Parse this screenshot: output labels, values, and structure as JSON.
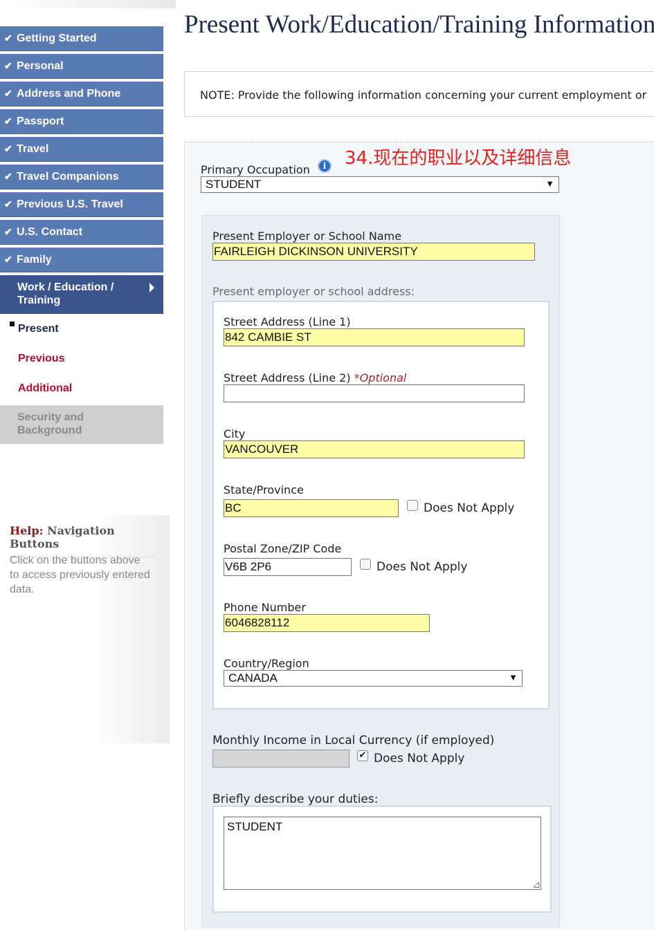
{
  "sidebar": {
    "completed_items": [
      {
        "label": "Getting Started"
      },
      {
        "label": "Personal"
      },
      {
        "label": "Address and Phone"
      },
      {
        "label": "Passport"
      },
      {
        "label": "Travel"
      },
      {
        "label": "Travel Companions"
      },
      {
        "label": "Previous U.S. Travel"
      },
      {
        "label": "U.S. Contact"
      },
      {
        "label": "Family"
      }
    ],
    "active_section": "Work / Education / Training",
    "sub_items": [
      {
        "label": "Present",
        "color": "#1d2b4f"
      },
      {
        "label": "Previous",
        "color": "#b0102e"
      },
      {
        "label": "Additional",
        "color": "#b0102e"
      }
    ],
    "disabled_section": "Security and Background",
    "check_glyph": "✔"
  },
  "help": {
    "prefix": "Help:",
    "title": "Navigation Buttons",
    "text": "Click on the buttons above to access previously entered data."
  },
  "page": {
    "title": "Present Work/Education/Training Information",
    "note": "NOTE: Provide the following information concerning your current employment or"
  },
  "annotation": "34.现在的职业以及详细信息",
  "form": {
    "primary_occupation": {
      "label": "Primary Occupation",
      "value": "STUDENT",
      "info_icon": "i"
    },
    "employer_name": {
      "label": "Present Employer or School Name",
      "value": "FAIRLEIGH DICKINSON UNIVERSITY"
    },
    "address_section_label": "Present employer or school address:",
    "street1": {
      "label": "Street Address (Line 1)",
      "value": "842 CAMBIE ST"
    },
    "street2": {
      "label": "Street Address (Line 2)",
      "optional": "*Optional",
      "value": ""
    },
    "city": {
      "label": "City",
      "value": "VANCOUVER"
    },
    "state": {
      "label": "State/Province",
      "value": "BC",
      "does_not_apply": "Does Not Apply",
      "checked": false
    },
    "postal": {
      "label": "Postal Zone/ZIP Code",
      "value": "V6B 2P6",
      "does_not_apply": "Does Not Apply",
      "checked": false
    },
    "phone": {
      "label": "Phone Number",
      "value": "6046828112"
    },
    "country": {
      "label": "Country/Region",
      "value": "CANADA"
    },
    "income": {
      "label": "Monthly Income in Local Currency (if employed)",
      "value": "",
      "does_not_apply": "Does Not Apply",
      "checked": true,
      "check_glyph": "✔"
    },
    "duties": {
      "label": "Briefly describe your duties:",
      "value": "STUDENT"
    }
  },
  "colors": {
    "nav_completed": "#5a7ab3",
    "nav_active": "#39558c",
    "highlight_input": "#ffffa8",
    "annotation": "#e0221e"
  }
}
